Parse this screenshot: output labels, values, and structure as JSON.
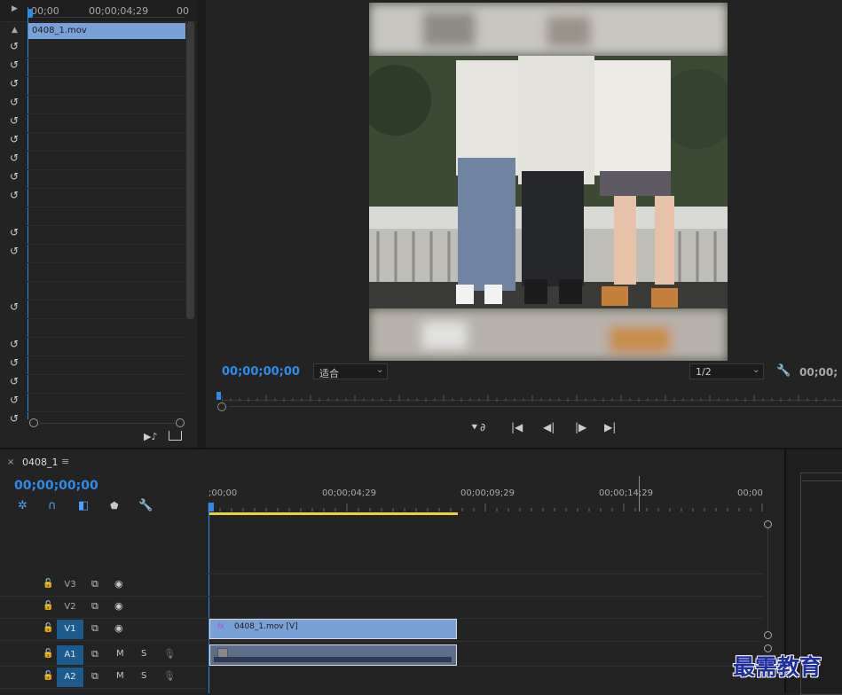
{
  "effect_controls": {
    "ruler_start": "00;00",
    "ruler_mid": "00;00;04;29",
    "ruler_end": "00",
    "clip_name": "0408_1.mov"
  },
  "program_monitor": {
    "timecode": "00;00;00;00",
    "zoom_label": "适合",
    "resolution_label": "1/2",
    "duration_timecode": "00;00;"
  },
  "timeline": {
    "tab_label": "0408_1",
    "timecode": "00;00;00;00",
    "ruler": [
      ";00;00",
      "00;00;04;29",
      "00;00;09;29",
      "00;00;14;29",
      "00;00"
    ],
    "tracks": [
      {
        "name": "V3"
      },
      {
        "name": "V2"
      },
      {
        "name": "V1"
      },
      {
        "name": "A1"
      },
      {
        "name": "A2"
      }
    ],
    "video_clip_label": "0408_1.mov [V]",
    "fx_badge": "fx",
    "m_label": "M",
    "s_label": "S"
  },
  "watermark": "最需教育",
  "colors": {
    "accent_blue": "#2d8ceb",
    "clip_blue": "#7aa0d8",
    "work_area_yellow": "#e8d040",
    "track_active": "#1d5a8e"
  }
}
